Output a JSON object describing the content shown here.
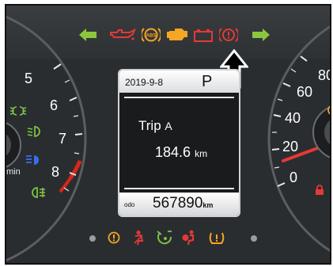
{
  "trip_display": {
    "date": "2019-9-8",
    "gear": "P",
    "trip_label": "Trip",
    "trip_id": "A",
    "distance": "184.6",
    "distance_unit": "km",
    "odo_label": "ODO",
    "odo_value": "567890",
    "odo_unit": "km"
  },
  "tachometer": {
    "ticks": [
      "5",
      "6",
      "7",
      "8"
    ],
    "partial_label": "min"
  },
  "speedometer": {
    "ticks": [
      "0",
      "20",
      "40",
      "60",
      "80"
    ]
  },
  "top_indicators": [
    {
      "icon": "left-turn-signal-icon",
      "color": "#8cc63f"
    },
    {
      "icon": "oil-pressure-icon",
      "color": "#e53935"
    },
    {
      "icon": "abs-icon",
      "color": "#f5a623"
    },
    {
      "icon": "check-engine-icon",
      "color": "#f5a623"
    },
    {
      "icon": "battery-icon",
      "color": "#e53935"
    },
    {
      "icon": "brake-warning-icon",
      "color": "#e53935"
    },
    {
      "icon": "right-turn-signal-icon",
      "color": "#8cc63f"
    }
  ],
  "left_indicators": [
    {
      "icon": "position-lights-icon",
      "color": "#7cc242"
    },
    {
      "icon": "low-beam-icon",
      "color": "#7cc242"
    },
    {
      "icon": "high-beam-icon",
      "color": "#3b6cf0"
    },
    {
      "icon": "rear-fog-light-icon",
      "color": "#7cc242"
    }
  ],
  "bottom_indicators": [
    {
      "icon": "dot-indicator-icon",
      "color": "#9a9da0"
    },
    {
      "icon": "power-steering-warning-icon",
      "color": "#f5a623"
    },
    {
      "icon": "seatbelt-warning-icon",
      "color": "#e53935"
    },
    {
      "icon": "steering-lock-icon",
      "color": "#7cc242"
    },
    {
      "icon": "airbag-warning-icon",
      "color": "#e53935"
    },
    {
      "icon": "tire-pressure-icon",
      "color": "#f5a623"
    },
    {
      "icon": "dot-indicator-icon",
      "color": "#9a9da0"
    }
  ],
  "colors": {
    "panel": "#2a2d30",
    "needle": "#e53935",
    "redline": "#d9261c"
  }
}
